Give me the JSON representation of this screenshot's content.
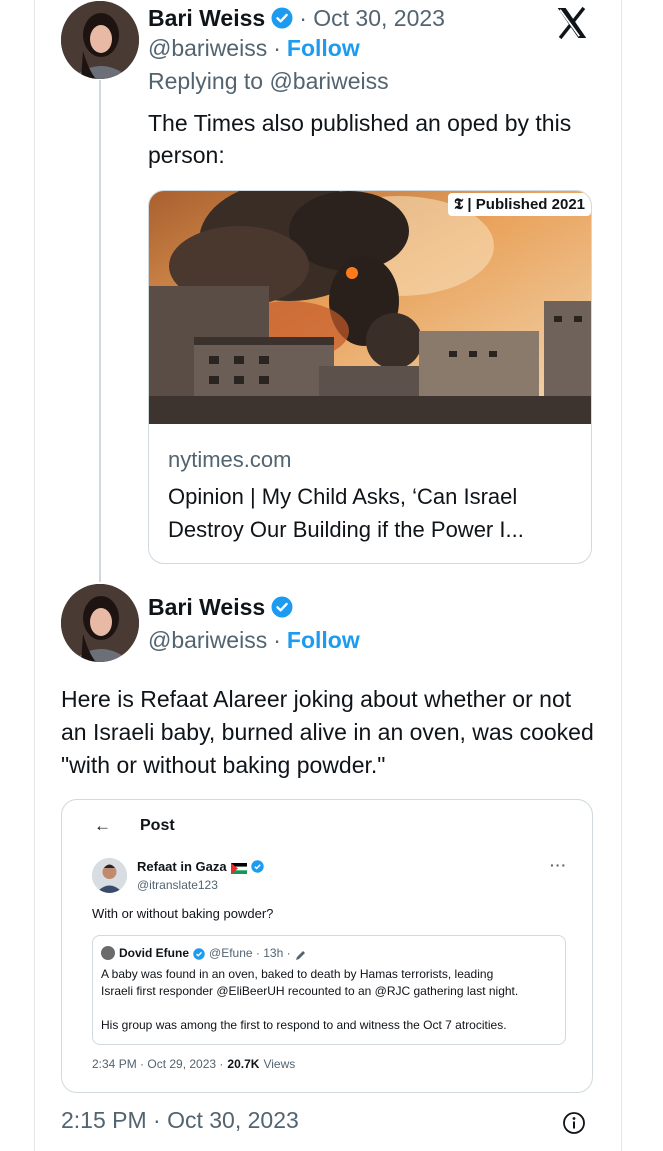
{
  "colors": {
    "accent": "#1d9bf0",
    "muted": "#536471",
    "text": "#0f1419",
    "border": "#cfd9de"
  },
  "reply_tweet": {
    "author_name": "Bari Weiss",
    "verified_icon": "verified-badge-icon",
    "date": "· Oct 30, 2023",
    "handle": "@bariweiss",
    "separator": "·",
    "follow": "Follow",
    "replying_to": "Replying to @bariweiss",
    "text": "The Times also published an oped by this person:",
    "x_logo_icon": "x-logo-icon",
    "link_card": {
      "badge_logo": "𝕿",
      "badge_text": "| Published 2021",
      "domain": "nytimes.com",
      "title": "Opinion | My Child Asks, ‘Can Israel Destroy Our Building if the Power I..."
    }
  },
  "main_tweet": {
    "author_name": "Bari Weiss",
    "handle": "@bariweiss",
    "separator": "·",
    "follow": "Follow",
    "text": "Here is Refaat Alareer joking about whether or not an Israeli baby, burned alive in an oven, was cooked \"with or without baking powder.\"",
    "embedded_post": {
      "back_icon": "back-arrow-icon",
      "header": "Post",
      "author_name": "Refaat in Gaza",
      "handle": "@itranslate123",
      "more_icon": "more-icon",
      "text": "With or without baking powder?",
      "quoted": {
        "author_name": "Dovid Efune",
        "handle": "@Efune · 13h ·",
        "line1": "A baby was found in an oven, baked to death by Hamas terrorists, leading",
        "line2": "Israeli first responder @EliBeerUH recounted to an @RJC gathering last night.",
        "line3": "His group was among the first to respond to and witness the Oct 7 atrocities."
      },
      "timestamp": "2:34 PM · Oct 29, 2023 ·",
      "views_count": "20.7K",
      "views_label": "Views"
    },
    "timestamp": "2:15 PM · Oct 30, 2023",
    "info_icon": "info-icon"
  }
}
